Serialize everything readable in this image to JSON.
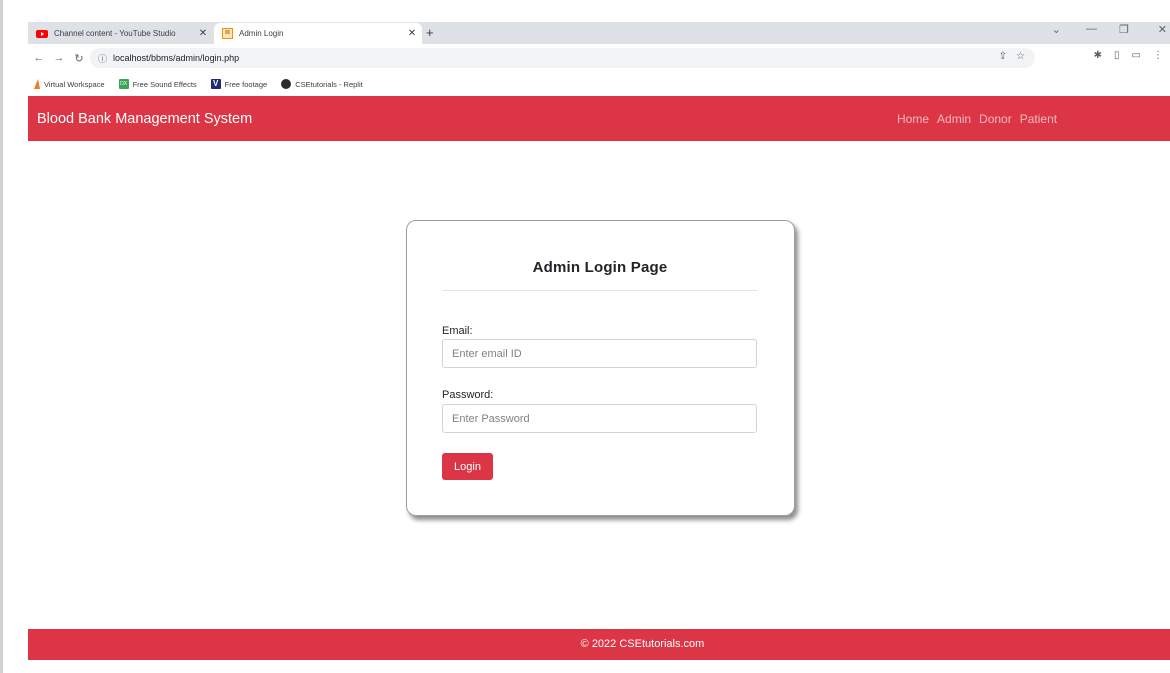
{
  "browser": {
    "tabs": [
      {
        "title": "Channel content - YouTube Studio",
        "active": false
      },
      {
        "title": "Admin Login",
        "active": true
      }
    ],
    "address": "localhost/bbms/admin/login.php",
    "bookmarks": [
      {
        "label": "Virtual Workspace"
      },
      {
        "label": "Free Sound Effects",
        "icon_text": "DX"
      },
      {
        "label": "Free footage",
        "icon_text": "V"
      },
      {
        "label": "CSEtutorials - Replit"
      }
    ]
  },
  "navbar": {
    "brand": "Blood Bank Management System",
    "links": [
      "Home",
      "Admin",
      "Donor",
      "Patient"
    ]
  },
  "login": {
    "title": "Admin Login Page",
    "email_label": "Email:",
    "email_placeholder": "Enter email ID",
    "password_label": "Password:",
    "password_placeholder": "Enter Password",
    "button": "Login"
  },
  "footer": {
    "text": "© 2022 CSEtutorials.com"
  },
  "colors": {
    "brand_red": "#dc3545"
  }
}
